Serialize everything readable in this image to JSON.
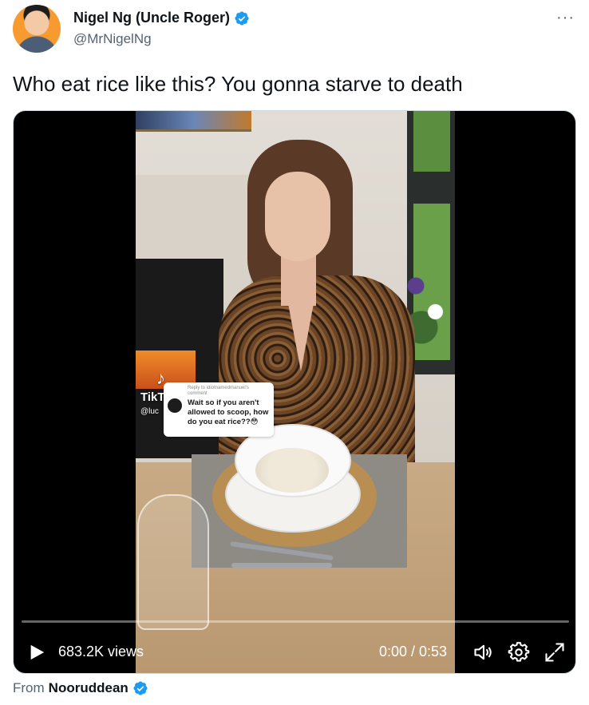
{
  "author": {
    "display_name": "Nigel Ng (Uncle Roger)",
    "handle": "@MrNigelNg",
    "verified": true
  },
  "more_menu_glyph": "···",
  "tweet": {
    "text": "Who eat rice like this? You gonna starve to death"
  },
  "video": {
    "tiktok_logo": "TikTok",
    "tiktok_user": "@luc",
    "comment_reply_label": "Reply to idiotnamedmanuel's comment",
    "comment_text": "Wait so if you aren't allowed to scoop, how do you eat rice??😳",
    "views": "683.2K views",
    "time": "0:00 / 0:53",
    "progress_fraction": 0
  },
  "source": {
    "from_label": "From",
    "from_name": "Nooruddean",
    "verified": true
  },
  "colors": {
    "verified_blue": "#1d9bf0",
    "secondary_text": "#536471",
    "primary_text": "#0f1419"
  }
}
